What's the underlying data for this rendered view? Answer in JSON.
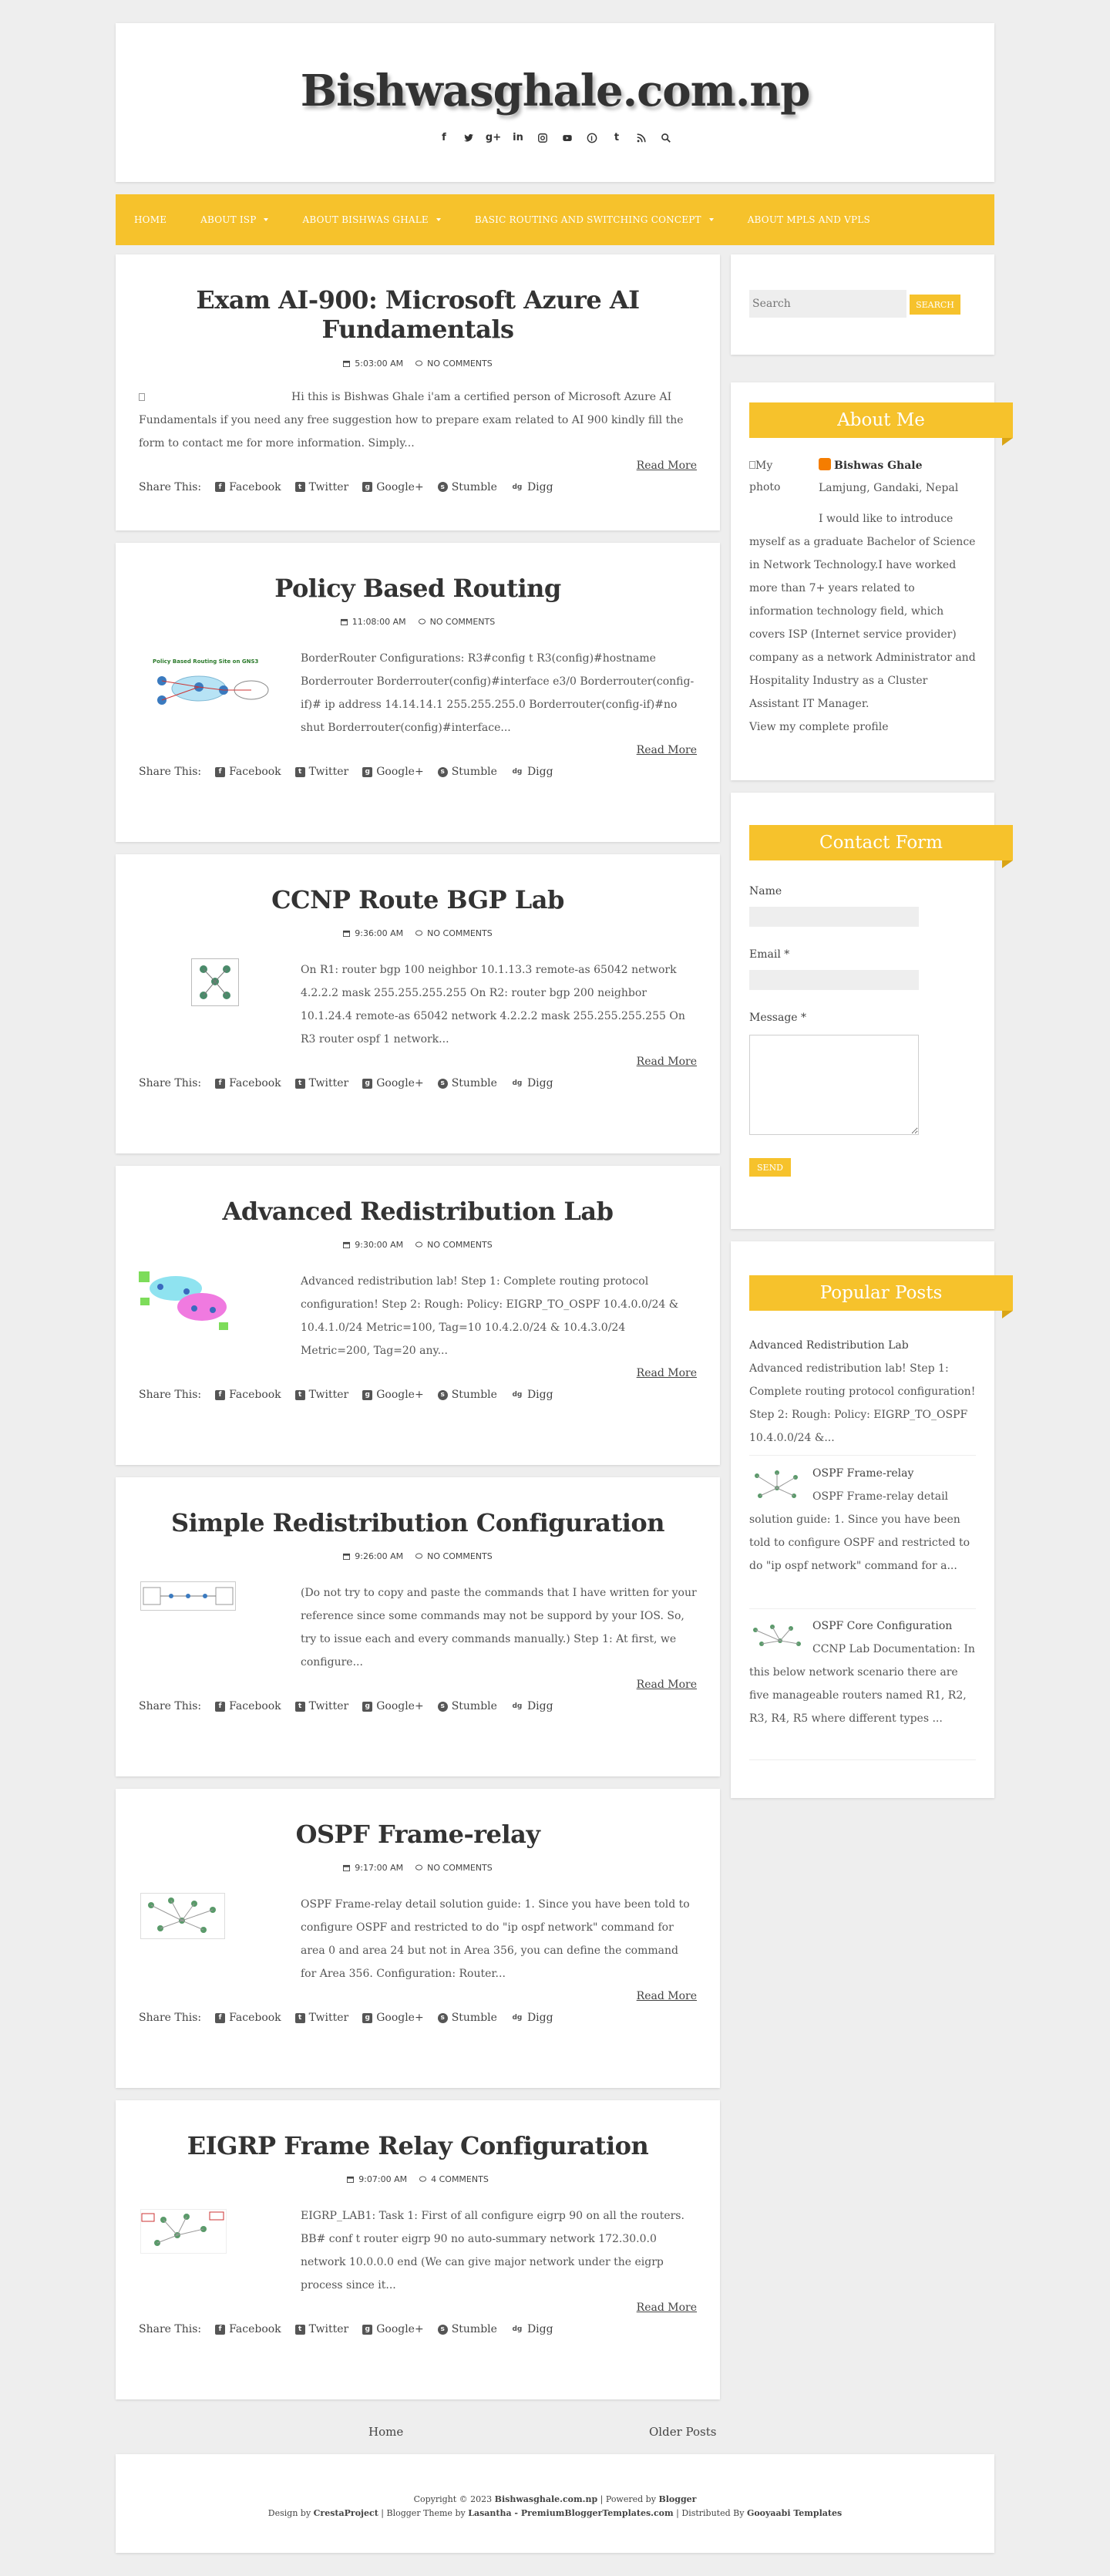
{
  "site": {
    "title": "Bishwasghale.com.np"
  },
  "social": [
    "facebook-icon",
    "twitter-icon",
    "google-plus-icon",
    "linkedin-icon",
    "instagram-icon",
    "youtube-icon",
    "pinterest-icon",
    "tumblr-icon",
    "rss-icon",
    "search-icon"
  ],
  "nav": [
    {
      "label": "Home",
      "dropdown": false
    },
    {
      "label": "About ISP",
      "dropdown": true
    },
    {
      "label": "About Bishwas Ghale",
      "dropdown": true
    },
    {
      "label": "Basic Routing and Switching Concept",
      "dropdown": true
    },
    {
      "label": "About MPLS and VPLS",
      "dropdown": false
    }
  ],
  "share": {
    "label": "Share This:",
    "facebook": "Facebook",
    "twitter": "Twitter",
    "google": "Google+",
    "stumble": "Stumble",
    "digg": "Digg"
  },
  "read_more": "Read More",
  "posts": [
    {
      "title": "Exam AI-900: Microsoft Azure AI Fundamentals",
      "time": "5:03:00 AM",
      "comments": "NO COMMENTS",
      "excerpt": "Hi this is Bishwas Ghale i'am a certified person of  Microsoft Azure AI Fundamentals if you need any free suggestion how to prepare exam related to AI 900  kindly fill the form to contact me for more information. Simply..."
    },
    {
      "title": "Policy Based Routing",
      "time": "11:08:00 AM",
      "comments": "NO COMMENTS",
      "thumb_caption": "Policy Based Routing Site on GNS3",
      "excerpt": "BorderRouter Configurations: R3#config t R3(config)#hostname Borderrouter Borderrouter(config)#interface e3/0 Borderrouter(config-if)# ip address 14.14.14.1 255.255.255.0 Borderrouter(config-if)#no shut Borderrouter(config)#interface..."
    },
    {
      "title": "CCNP Route BGP Lab",
      "time": "9:36:00 AM",
      "comments": "NO COMMENTS",
      "excerpt": "On R1: router bgp 100 neighbor 10.1.13.3 remote-as 65042 network 4.2.2.2 mask 255.255.255.255 On R2: router bgp 200 neighbor 10.1.24.4 remote-as 65042 network 4.2.2.2 mask 255.255.255.255 On R3 router ospf 1 network..."
    },
    {
      "title": "Advanced Redistribution Lab",
      "time": "9:30:00 AM",
      "comments": "NO COMMENTS",
      "excerpt": "Advanced redistribution lab! Step 1: Complete routing protocol configuration! Step 2: Rough: Policy: EIGRP_TO_OSPF 10.4.0.0/24 & 10.4.1.0/24 Metric=100, Tag=10 10.4.2.0/24 & 10.4.3.0/24 Metric=200, Tag=20 any..."
    },
    {
      "title": "Simple Redistribution Configuration",
      "time": "9:26:00 AM",
      "comments": "NO COMMENTS",
      "excerpt": "(Do not try to copy and paste the commands that I have written for your reference since some commands may not be suppord by your IOS. So, try to issue each and every commands manually.) Step 1: At first, we configure..."
    },
    {
      "title": "OSPF Frame-relay",
      "time": "9:17:00 AM",
      "comments": "NO COMMENTS",
      "excerpt": "OSPF Frame-relay detail solution guide: 1. Since you have been told to configure OSPF and restricted to do \"ip ospf network\" command for area 0 and area 24 but not in Area 356, you can define the command for Area 356. Configuration: Router..."
    },
    {
      "title": "EIGRP Frame Relay Configuration",
      "time": "9:07:00 AM",
      "comments": "4 COMMENTS",
      "excerpt": "EIGRP_LAB1: Task 1: First of all configure eigrp 90 on all the routers. BB# conf t router eigrp 90 no auto-summary network 172.30.0.0 network 10.0.0.0 end (We can give major network under the eigrp process since it..."
    }
  ],
  "sidebar": {
    "search": {
      "placeholder": "Search",
      "button": "Search"
    },
    "about": {
      "heading": "About Me",
      "photo_alt": "My photo",
      "name": "Bishwas Ghale",
      "location": "Lamjung, Gandaki, Nepal",
      "bio_line1": "I would like to introduce",
      "bio_rest": "myself as a graduate Bachelor of Science in Network Technology.I have worked more than 7+ years related to information technology field, which covers ISP (Internet service provider) company as a network Administrator and Hospitality Industry as a Cluster Assistant IT Manager.",
      "profile_link": "View my complete profile"
    },
    "contact": {
      "heading": "Contact Form",
      "name_label": "Name",
      "email_label": "Email *",
      "message_label": "Message *",
      "send": "Send"
    },
    "popular": {
      "heading": "Popular Posts",
      "items": [
        {
          "title": "Advanced Redistribution Lab",
          "snippet": "Advanced redistribution lab! Step 1: Complete routing protocol configuration! Step 2: Rough: Policy: EIGRP_TO_OSPF 10.4.0.0/24 &..."
        },
        {
          "title": "OSPF Frame-relay",
          "snippet": "OSPF Frame-relay detail solution guide: 1. Since you have been told to configure OSPF and restricted to do \"ip ospf network\" command for a..."
        },
        {
          "title": "OSPF Core Configuration",
          "snippet": "CCNP Lab Documentation: In this below network scenario there are five manageable routers named R1, R2, R3, R4, R5 where different types ..."
        }
      ]
    }
  },
  "pager": {
    "home": "Home",
    "older": "Older Posts"
  },
  "footer": {
    "copyright": "Copyright © 2023",
    "site": "Bishwasghale.com.np",
    "powered": "| Powered by",
    "blogger": "Blogger",
    "design_by": "Design by",
    "cresta": "CrestaProject",
    "theme_by": "| Blogger Theme by",
    "lasantha": "Lasantha - PremiumBloggerTemplates.com",
    "distributed": "| Distributed By",
    "gooyaabi": "Gooyaabi Templates"
  },
  "colors": {
    "accent": "#f6c22c",
    "background": "#eeeeee",
    "card": "#ffffff",
    "text": "#444444"
  }
}
